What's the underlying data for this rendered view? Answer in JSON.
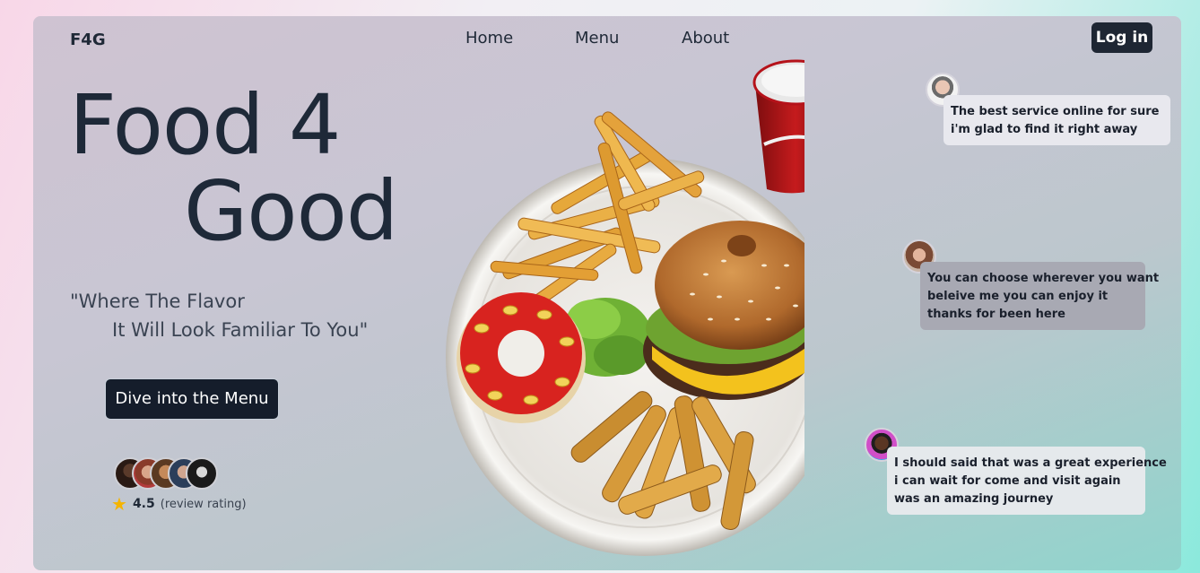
{
  "brand": "F4G",
  "nav": {
    "home": "Home",
    "menu": "Menu",
    "about": "About",
    "login": "Log in"
  },
  "hero": {
    "title_line1": "Food 4",
    "title_line2": "Good",
    "tagline_line1": "\"Where The Flavor",
    "tagline_line2": "It Will Look Familiar To You\"",
    "cta": "Dive into the Menu"
  },
  "rating": {
    "value": "4.5",
    "label": "(review rating)",
    "icon": "star-icon"
  },
  "testimonials": [
    {
      "lines": [
        "The best service online for sure",
        "i'm glad to find it right away"
      ]
    },
    {
      "lines": [
        "You can choose wherever you want",
        "beleive me you can enjoy it",
        "thanks for been here"
      ]
    },
    {
      "lines": [
        "I should said that was a great experience",
        "i can wait for come and visit again",
        "was an amazing journey"
      ]
    }
  ],
  "colors": {
    "dark": "#1e2633",
    "accent_star": "#f5b400",
    "ketchup": "#d8231f"
  }
}
